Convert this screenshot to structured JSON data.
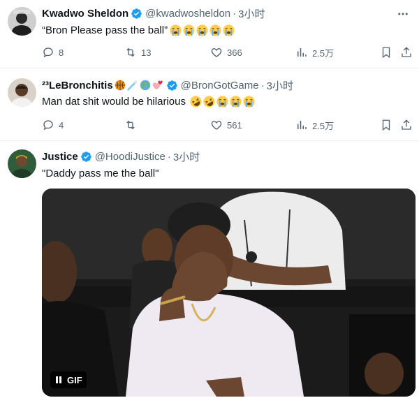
{
  "tweets": [
    {
      "name": "Kwadwo Sheldon",
      "handle": "@kwadwosheldon",
      "time": "3小时",
      "text": "“Bron Please pass the ball”",
      "emojis": [
        "sob",
        "sob",
        "sob",
        "sob",
        "sob"
      ],
      "stats": {
        "replies": "8",
        "retweets": "13",
        "likes": "366",
        "views": "2.5万"
      }
    },
    {
      "name": "²³LeBronchitis",
      "name_emojis": [
        "basketball",
        "comet",
        "globe",
        "hearts"
      ],
      "handle": "@BronGotGame",
      "time": "3小时",
      "text": "Man dat shit would be hilarious",
      "emojis": [
        "rofl",
        "rofl",
        "sob",
        "sob",
        "sob"
      ],
      "stats": {
        "replies": "4",
        "retweets": "",
        "likes": "561",
        "views": "2.5万"
      }
    },
    {
      "name": "Justice",
      "handle": "@HoodiJustice",
      "time": "3小时",
      "text": "\"Daddy pass me the ball\"",
      "media": {
        "type": "gif",
        "badge": "GIF"
      }
    }
  ],
  "colors": {
    "verified": "#1d9bf0",
    "muted": "#536471",
    "text": "#0f1419"
  }
}
